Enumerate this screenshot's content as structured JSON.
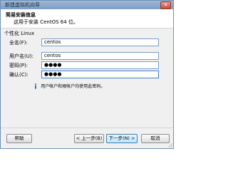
{
  "window": {
    "title": "新建虚拟机向导",
    "close_glyph": "✕"
  },
  "header": {
    "title": "简易安装信息",
    "subtitle": "这用于安装 CentOS 64 位。"
  },
  "personalize": {
    "section_label": "个性化 Linux",
    "fields": [
      {
        "label": "全名(F):",
        "value": "centos"
      },
      {
        "label": "用户名(U):",
        "value": "centos"
      },
      {
        "label": "密码(P):",
        "value": "●●●●"
      },
      {
        "label": "确认(C):",
        "value": "●●●●"
      }
    ],
    "info_text": "用户帐户和根帐户均使用此密码。"
  },
  "footer": {
    "help_label": "帮助",
    "back_label": "< 上一步(B)",
    "next_label": "下一步(N) >",
    "cancel_label": "取消"
  },
  "colors": {
    "titlebar": "#8aa6cc",
    "field_border": "#7a9cc8",
    "focus_border": "#3d7bd0",
    "info_icon": "#2f6fba"
  },
  "icons": {
    "info": "info-icon",
    "close": "close-icon",
    "grip": "resize-grip-icon"
  }
}
